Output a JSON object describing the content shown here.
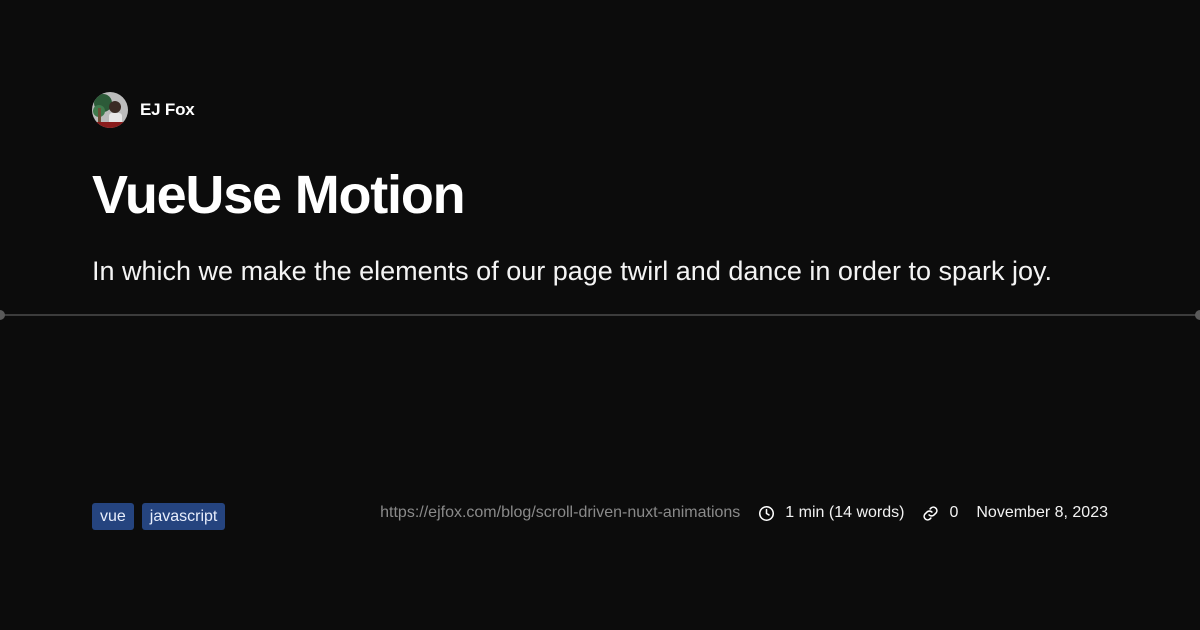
{
  "author": {
    "name": "EJ Fox",
    "avatar_icon": "author-avatar"
  },
  "post": {
    "title": "VueUse Motion",
    "summary": "In which we make the elements of our page twirl and dance in order to spark joy."
  },
  "tags": [
    {
      "label": "vue"
    },
    {
      "label": "javascript"
    }
  ],
  "meta": {
    "url": "https://ejfox.com/blog/scroll-driven-nuxt-animations",
    "reading_time": "1 min (14 words)",
    "reading_time_icon": "clock-icon",
    "link_count": "0",
    "link_icon": "link-icon",
    "date": "November 8, 2023"
  },
  "colors": {
    "background": "#0c0c0c",
    "tag_background": "#25447f",
    "url_text": "#8a8a8a"
  }
}
